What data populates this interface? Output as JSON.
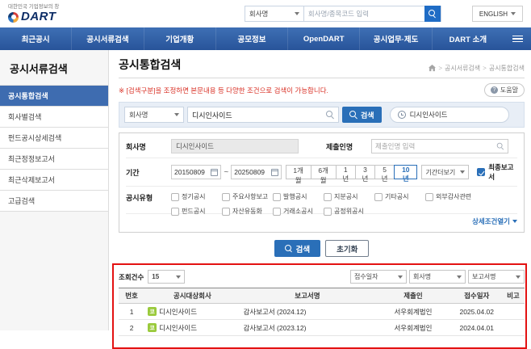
{
  "colors": {
    "nav_blue": "#2f62a7",
    "accent_blue": "#2a6fb8",
    "notice_red": "#d93025",
    "annotation_red": "#e31212",
    "kosdaq_badge_green": "#9aca3c"
  },
  "header": {
    "slogan": "대한민국 기업정보의 창",
    "logo": "DART",
    "company_select": "회사명",
    "search_placeholder": "회사명/종목코드 입력",
    "english": "ENGLISH"
  },
  "nav": {
    "items": [
      "최근공시",
      "공시서류검색",
      "기업개황",
      "공모정보",
      "OpenDART",
      "공시업무·제도",
      "DART 소개"
    ]
  },
  "sidebar": {
    "title": "공시서류검색",
    "items": [
      {
        "label": "공시통합검색",
        "active": true
      },
      {
        "label": "회사별검색",
        "active": false
      },
      {
        "label": "펀드공시상세검색",
        "active": false
      },
      {
        "label": "최근정정보고서",
        "active": false
      },
      {
        "label": "최근삭제보고서",
        "active": false
      },
      {
        "label": "고급검색",
        "active": false
      }
    ]
  },
  "main": {
    "title": "공시통합검색",
    "breadcrumb": [
      "공시서류검색",
      "공시통합검색"
    ],
    "notice": "※ [검색구분]을 조정하면 본문내용 등 다양한 조건으로 검색이 가능합니다.",
    "help": "도움말"
  },
  "quick_search": {
    "category": "회사명",
    "query": "디시인사이드",
    "button": "검색",
    "recent": "디시인사이드"
  },
  "filter": {
    "company": {
      "label": "회사명",
      "value": "디시인사이드"
    },
    "submitter": {
      "label": "제출인명",
      "placeholder": "제출인명 입력"
    },
    "period": {
      "label": "기간",
      "start": "20150809",
      "end": "20250809",
      "ranges": [
        "1개월",
        "6개월",
        "1년",
        "3년",
        "5년",
        "10년"
      ],
      "selected": "10년",
      "more": "기간더보기",
      "final_report": "최종보고서",
      "final_report_checked": true
    },
    "types": {
      "label": "공시유형",
      "options": [
        "정기공시",
        "주요사항보고",
        "발행공시",
        "지분공시",
        "기타공시",
        "외부감사관련",
        "펀드공시",
        "자산유동화",
        "거래소공시",
        "공정위공시"
      ]
    },
    "detail_toggle": "상세조건열기",
    "search_button": "검색",
    "reset_button": "초기화"
  },
  "results": {
    "count_label": "조회건수",
    "count_value": "15",
    "sorts": [
      "접수일자",
      "회사명",
      "보고서명"
    ],
    "table": {
      "headers": [
        "번호",
        "공시대상회사",
        "보고서명",
        "제출인",
        "접수일자",
        "비고"
      ],
      "rows": [
        {
          "no": "1",
          "market_badge": "코",
          "company": "디시인사이드",
          "report": "감사보고서 (2024.12)",
          "submitter": "서우회계법인",
          "date": "2025.04.02",
          "note": ""
        },
        {
          "no": "2",
          "market_badge": "코",
          "company": "디시인사이드",
          "report": "감사보고서 (2023.12)",
          "submitter": "서우회계법인",
          "date": "2024.04.01",
          "note": ""
        }
      ]
    }
  }
}
